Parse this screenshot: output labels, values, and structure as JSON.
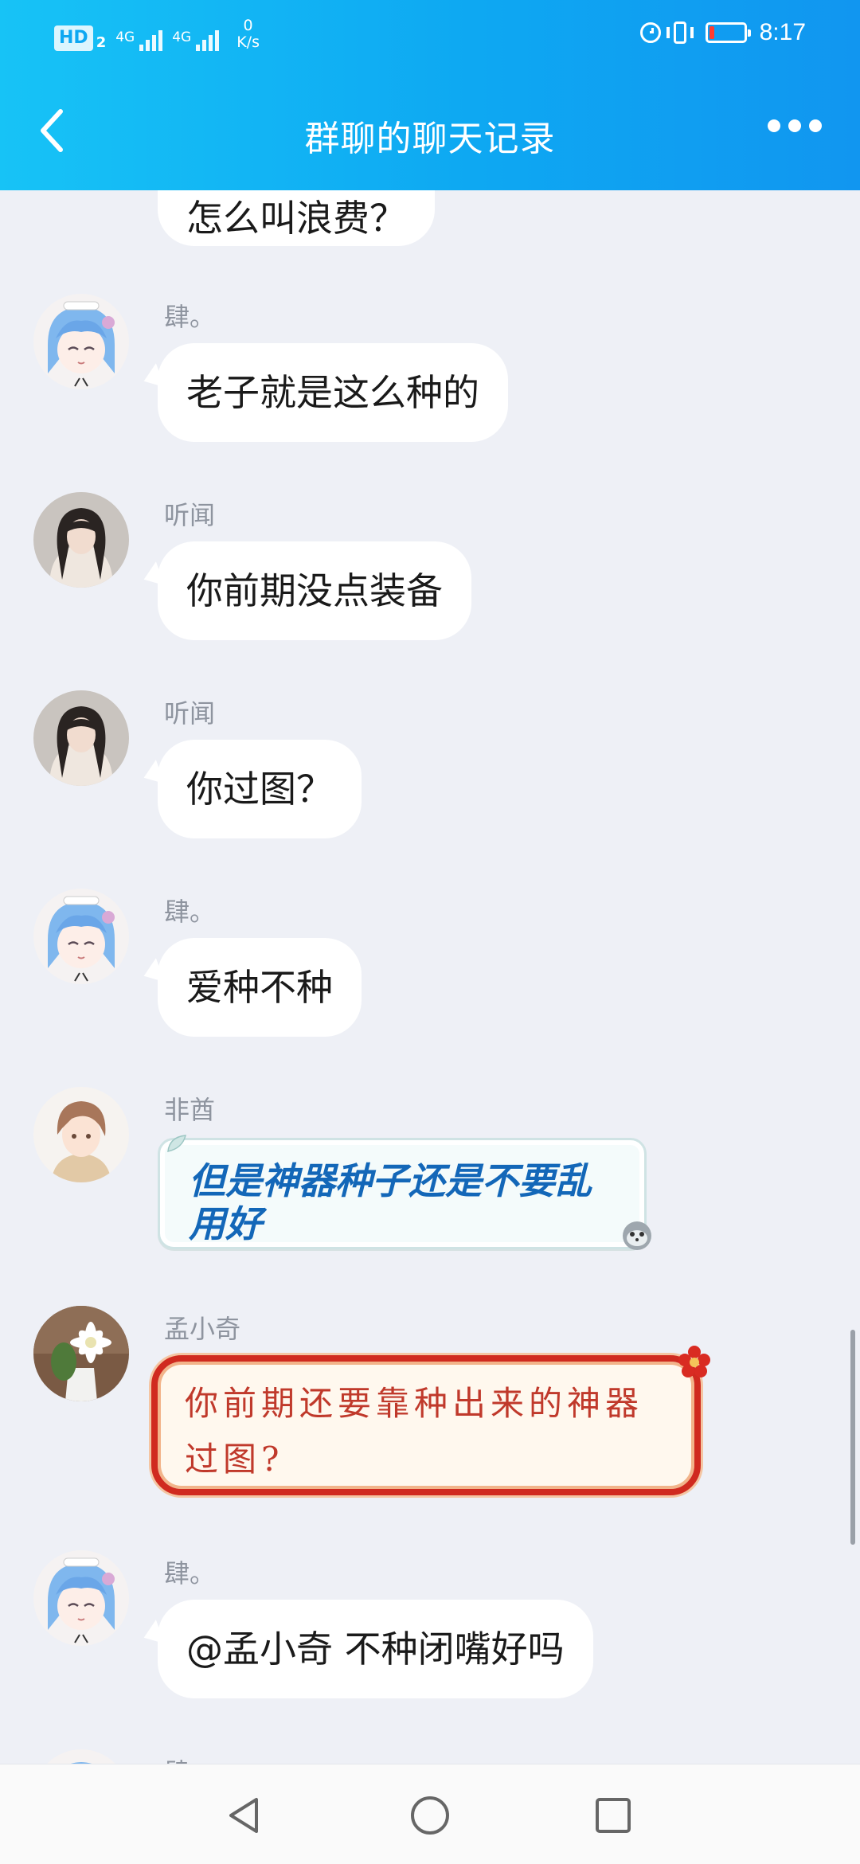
{
  "status_bar": {
    "hd": "HD",
    "hd_sub": "2",
    "signal1": "4G",
    "signal2": "4G",
    "net_speed": "0",
    "net_unit": "K/s",
    "time": "8:17",
    "battery_level": 0.15
  },
  "header": {
    "title": "群聊的聊天记录"
  },
  "messages": [
    {
      "sender": "",
      "text": "怎么叫浪费？",
      "avatar": "none"
    },
    {
      "sender": "肆。",
      "text": "老子就是这么种的",
      "avatar": "blue-hair-anime-avatar"
    },
    {
      "sender": "听闻",
      "text": "你前期没点装备",
      "avatar": "girl-photo-avatar"
    },
    {
      "sender": "听闻",
      "text": "你过图？",
      "avatar": "girl-photo-avatar"
    },
    {
      "sender": "肆。",
      "text": "爱种不种",
      "avatar": "blue-hair-anime-avatar"
    },
    {
      "sender": "非酋",
      "text": "但是神器种子还是不要乱用好",
      "avatar": "anime-boy-avatar"
    },
    {
      "sender": "孟小奇",
      "text": "你前期还要靠种出来的神器过图?",
      "avatar": "cactus-flower-avatar"
    },
    {
      "sender": "肆。",
      "text": "@孟小奇 不种闭嘴好吗",
      "avatar": "blue-hair-anime-avatar"
    },
    {
      "sender": "肆",
      "text": "",
      "avatar": "blue-hair-anime-avatar"
    }
  ],
  "colors": {
    "header_start": "#17c3f6",
    "header_end": "#1196f0",
    "chat_bg": "#eef0f6",
    "bubble_bg": "#ffffff",
    "blue_bubble_text": "#1367b8",
    "red_bubble_border": "#d02a1f"
  },
  "icons": {
    "back": "chevron-left-icon",
    "more": "more-dots-icon",
    "nav_back": "triangle-back-icon",
    "nav_home": "circle-home-icon",
    "nav_recent": "square-recent-icon"
  }
}
